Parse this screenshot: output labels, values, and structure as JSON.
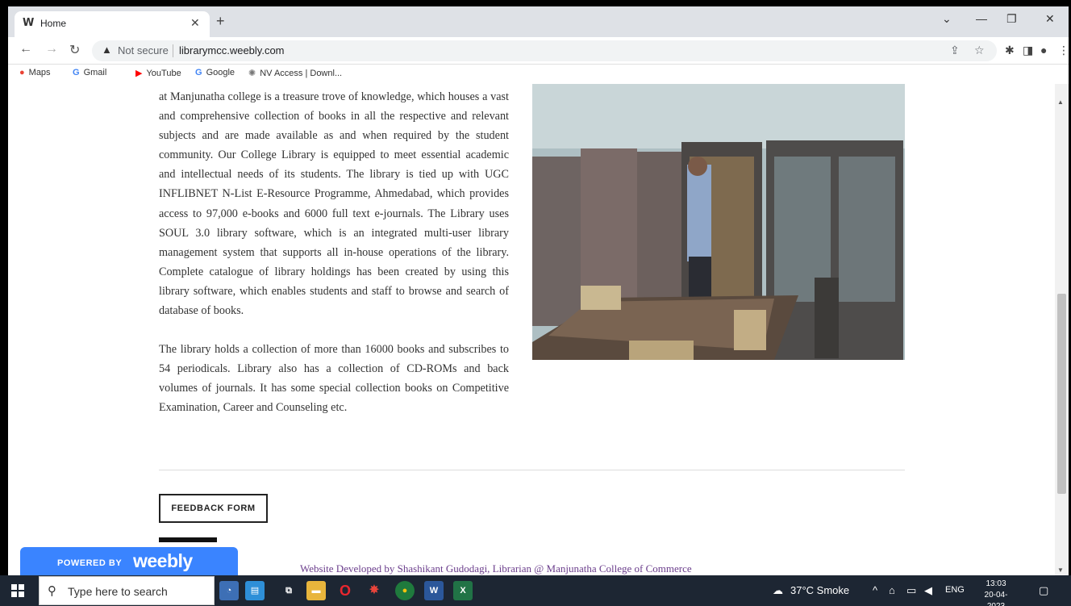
{
  "browser": {
    "tab": {
      "title": "Home",
      "favicon": "W"
    },
    "address": {
      "security_label": "Not secure",
      "url": "librarymcc.weebly.com"
    },
    "bookmarks": [
      {
        "label": "Maps",
        "icon": "maps-pin-icon"
      },
      {
        "label": "Gmail",
        "icon": "google-g-icon"
      },
      {
        "label": "YouTube",
        "icon": "youtube-icon"
      },
      {
        "label": "Google",
        "icon": "google-g-icon"
      },
      {
        "label": "NV Access | Downl...",
        "icon": "nvaccess-icon"
      }
    ]
  },
  "page": {
    "paragraphs": [
      "at Manjunatha college is a treasure trove of knowledge, which houses a vast and comprehensive collection of books in all the respective and relevant subjects and are made available as and when required by the student community. Our College Library is equipped to meet essential academic and intellectual needs of its students. The library is tied up with UGC INFLIBNET N-List E-Resource Programme, Ahmedabad, which provides access to 97,000 e-books and 6000 full text e-journals. The Library uses SOUL 3.0 library software, which is an integrated multi-user library management system that supports all in-house operations of the library. Complete catalogue of library holdings has been created by using this library software, which enables students and staff to browse and search of database of books.",
      "The library holds a collection of more than 16000 books and subscribes to 54 periodicals. Library also has a collection of CD-ROMs and back volumes of journals. It has some special collection books on Competitive Examination, Career and Counseling etc."
    ],
    "feedback_button": "FEEDBACK FORM",
    "footer_credit": "Website Developed by Shashikant Gudodagi, Librarian @ Manjunatha College of Commerce",
    "weebly": {
      "powered_by": "POWERED BY",
      "logo": "weebly"
    }
  },
  "taskbar": {
    "search_placeholder": "Type here to search",
    "weather": "37°C  Smoke",
    "language": "ENG",
    "time": "13:03",
    "date": "20-04-2023"
  },
  "colors": {
    "weebly_blue": "#3a84ff",
    "credit_purple": "#6b3e8c",
    "taskbar": "#1d2633"
  }
}
